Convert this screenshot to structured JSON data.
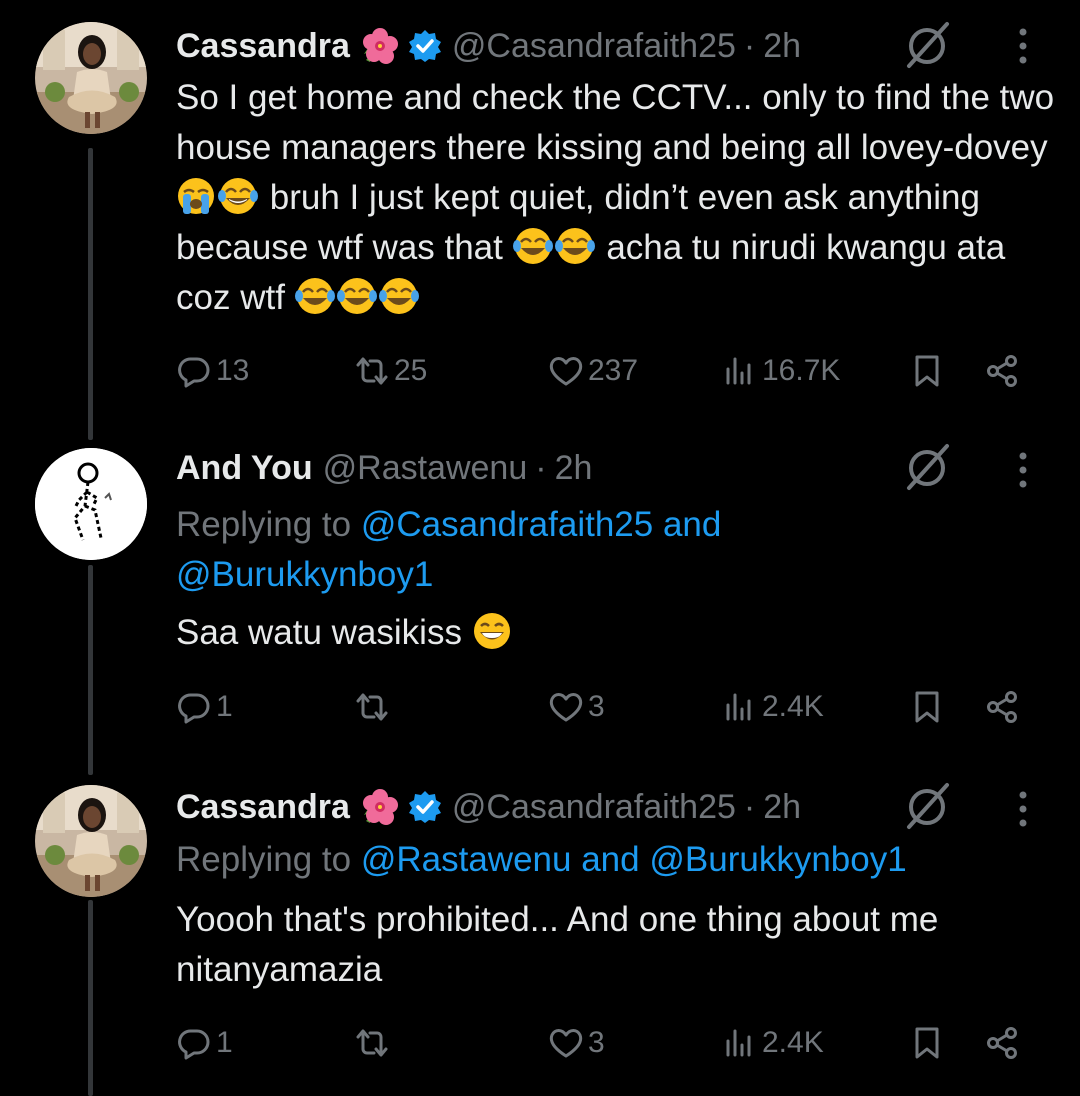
{
  "tweets": [
    {
      "name": "Cassandra",
      "handle": "@Casandrafaith25",
      "time": "2h",
      "text_parts": [
        "So I get home and check the CCTV... only to find the two house managers there kissing and being all lovey-dovey",
        "bruh I just kept quiet, didn’t even ask anything because wtf was that",
        "acha tu nirudi kwangu ata coz wtf"
      ],
      "replies": "13",
      "reposts": "25",
      "likes": "237",
      "views": "16.7K"
    },
    {
      "name": "And You",
      "handle": "@Rastawenu",
      "time": "2h",
      "replying_label": "Replying to",
      "replying_to_1": "@Casandrafaith25",
      "and": "and",
      "replying_to_2": "@Burukkynboy1",
      "text": "Saa watu wasikiss",
      "replies": "1",
      "reposts": "",
      "likes": "3",
      "views": "2.4K"
    },
    {
      "name": "Cassandra",
      "handle": "@Casandrafaith25",
      "time": "2h",
      "replying_label": "Replying to",
      "replying_to_1": "@Rastawenu",
      "and": "and",
      "replying_to_2": "@Burukkynboy1",
      "text": "Yoooh that's prohibited... And one thing about me nitanyamazia",
      "replies": "1",
      "reposts": "",
      "likes": "3",
      "views": "2.4K"
    }
  ],
  "icons": {
    "reply": "reply-icon",
    "repost": "repost-icon",
    "like": "heart-icon",
    "views": "views-icon",
    "bookmark": "bookmark-icon",
    "share": "share-icon",
    "grok": "grok-icon",
    "more": "more-icon",
    "verified": "verified-badge-icon",
    "flower": "hibiscus-emoji-icon"
  },
  "colors": {
    "background": "#000000",
    "text": "#e7e9ea",
    "muted": "#71767b",
    "link": "#1d9bf0",
    "verified": "#1d9bf0"
  }
}
